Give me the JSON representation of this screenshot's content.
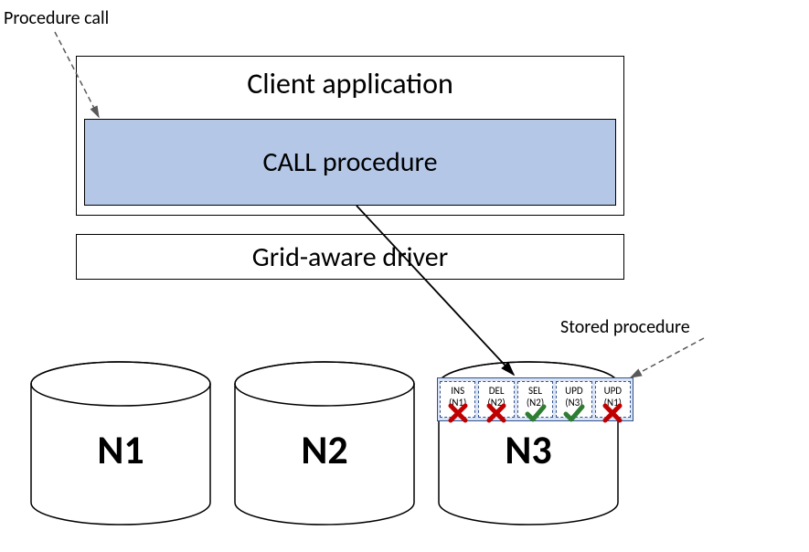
{
  "labels": {
    "procedure_call": "Procedure call",
    "stored_procedure": "Stored procedure"
  },
  "client": {
    "title": "Client application",
    "call": "CALL procedure"
  },
  "driver": "Grid-aware driver",
  "nodes": [
    "N1",
    "N2",
    "N3"
  ],
  "stored_ops": [
    {
      "op": "INS",
      "node": "(N1)",
      "ok": false
    },
    {
      "op": "DEL",
      "node": "(N2)",
      "ok": false
    },
    {
      "op": "SEL",
      "node": "(N2)",
      "ok": true
    },
    {
      "op": "UPD",
      "node": "(N3)",
      "ok": true
    },
    {
      "op": "UPD",
      "node": "(N1)",
      "ok": false
    }
  ]
}
